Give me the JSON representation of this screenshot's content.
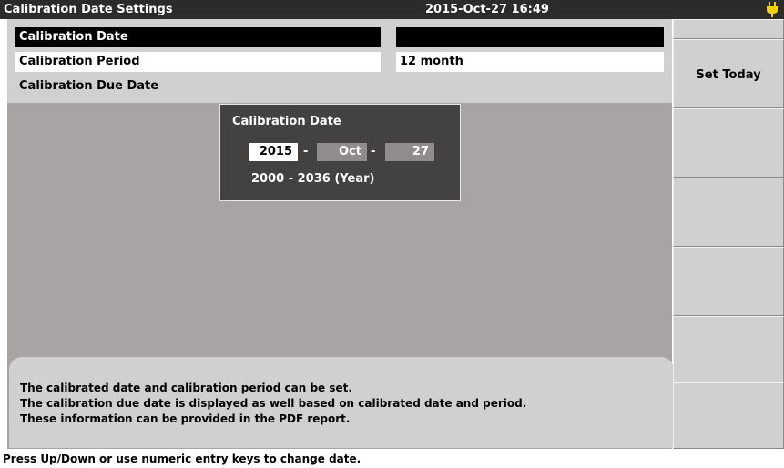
{
  "titlebar": {
    "title": "Calibration Date Settings",
    "clock": "2015-Oct-27 16:49",
    "power_icon": "power-plug-icon"
  },
  "settings": {
    "cal_date_label": "Calibration Date",
    "cal_date_value": "",
    "cal_period_label": "Calibration Period",
    "cal_period_value": "12 month",
    "cal_due_label": "Calibration Due Date"
  },
  "dialog": {
    "title": "Calibration Date",
    "year": "2015",
    "month": "Oct",
    "day": "27",
    "separator": "-",
    "range": "2000 - 2036 (Year)"
  },
  "info": {
    "lines": [
      "The calibrated date and calibration period can be set.",
      "The calibration due date is displayed as well based on calibrated date and period.",
      "These information can be provided in the PDF report."
    ]
  },
  "status": {
    "hint": "Press Up/Down or use numeric entry keys to change date."
  },
  "softkeys": {
    "set_today": "Set Today"
  },
  "colors": {
    "titlebar_bg": "#2b2b2b",
    "panel_bg": "#d0d0d0",
    "main_bg": "#a8a4a4",
    "dialog_bg": "#444141",
    "selected_bg": "#000000",
    "power_icon": "#f2d200"
  }
}
